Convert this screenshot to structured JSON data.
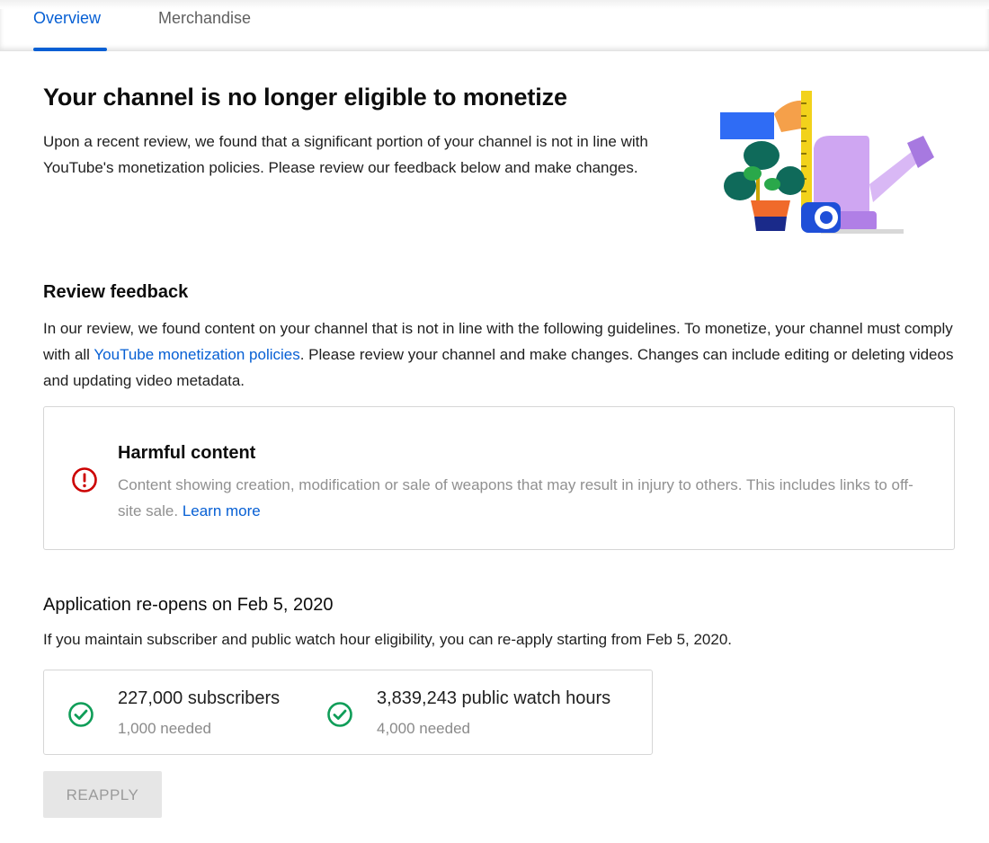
{
  "tabs": [
    {
      "label": "Overview",
      "selected": true
    },
    {
      "label": "Merchandise",
      "selected": false
    }
  ],
  "header": {
    "title": "Your channel is no longer eligible to monetize",
    "description": "Upon a recent review, we found that a significant portion of your channel is not in line with YouTube's monetization policies. Please review our feedback below and make changes."
  },
  "review": {
    "heading": "Review feedback",
    "text_before_link": "In our review, we found content on your channel that is not in line with the following guidelines. To monetize, your channel must comply with all ",
    "link_label": "YouTube monetization policies",
    "text_after_link": ". Please review your channel and make changes. Changes can include editing or deleting videos and updating video metadata."
  },
  "issue": {
    "icon": "error-icon",
    "title": "Harmful content",
    "description": "Content showing creation, modification or sale of weapons that may result in injury to others. This includes links to off-site sale. ",
    "link_label": "Learn more"
  },
  "reapplication": {
    "heading": "Application re-opens on Feb 5, 2020",
    "text": "If you maintain subscriber and public watch hour eligibility, you can re-apply starting from Feb 5, 2020.",
    "stats": [
      {
        "icon": "check-circle-icon",
        "value": "227,000 subscribers",
        "needed": "1,000 needed"
      },
      {
        "icon": "check-circle-icon",
        "value": "3,839,243 public watch hours",
        "needed": "4,000 needed"
      }
    ],
    "button_label": "REAPPLY"
  },
  "colors": {
    "accent": "#065fd4",
    "error": "#cc0000",
    "success": "#0f9d58"
  }
}
